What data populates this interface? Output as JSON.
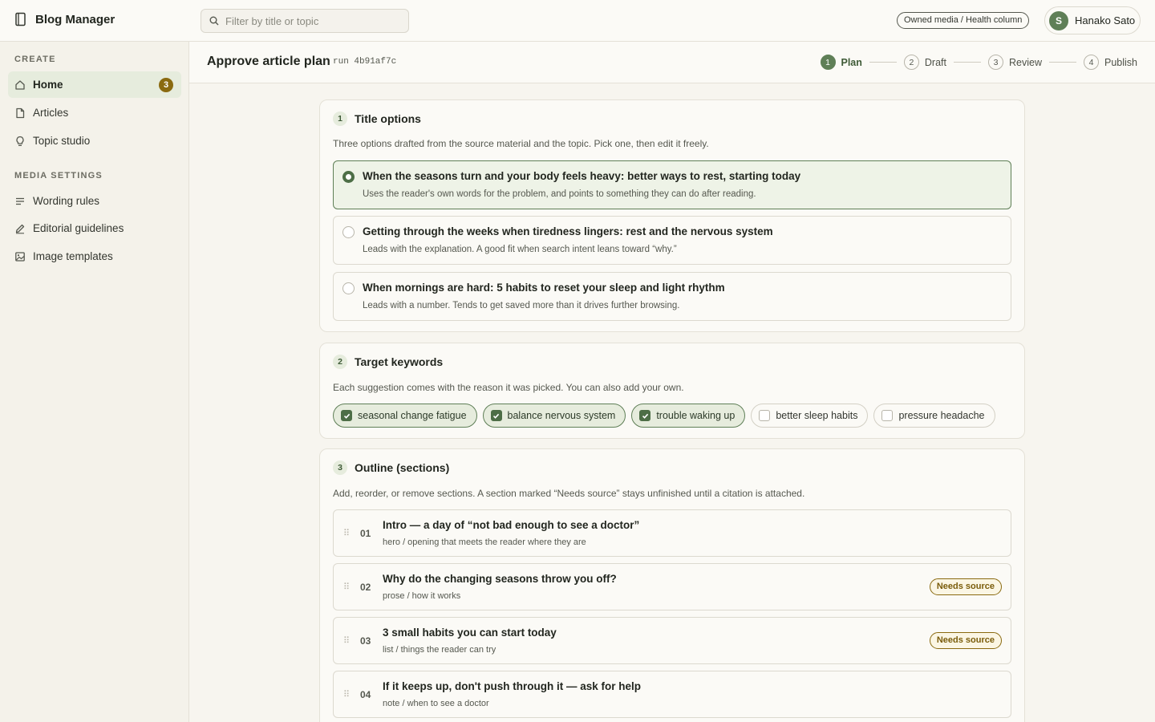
{
  "app": {
    "title": "Blog Manager"
  },
  "search": {
    "placeholder": "Filter by title or topic",
    "value": ""
  },
  "workspace": {
    "label": "Owned media / Health column"
  },
  "user": {
    "initial": "S",
    "name": "Hanako Sato"
  },
  "sidebar": {
    "create_heading": "CREATE",
    "create_items": [
      {
        "label": "Home",
        "icon": "home-icon",
        "badge": "3",
        "active": true
      },
      {
        "label": "Articles",
        "icon": "file-icon"
      },
      {
        "label": "Topic studio",
        "icon": "lightbulb-icon"
      }
    ],
    "media_heading": "MEDIA SETTINGS",
    "media_items": [
      {
        "label": "Wording rules",
        "icon": "lines-icon"
      },
      {
        "label": "Editorial guidelines",
        "icon": "pen-icon"
      },
      {
        "label": "Image templates",
        "icon": "image-icon"
      }
    ]
  },
  "header": {
    "title": "Approve article plan",
    "run_id": "run 4b91af7c",
    "steps": [
      {
        "num": "1",
        "label": "Plan",
        "active": true
      },
      {
        "num": "2",
        "label": "Draft"
      },
      {
        "num": "3",
        "label": "Review"
      },
      {
        "num": "4",
        "label": "Publish"
      }
    ]
  },
  "titles_card": {
    "num": "1",
    "title": "Title options",
    "desc": "Three options drafted from the source material and the topic. Pick one, then edit it freely.",
    "options": [
      {
        "title": "When the seasons turn and your body feels heavy: better ways to rest, starting today",
        "sub": "Uses the reader's own words for the problem, and points to something they can do after reading.",
        "selected": true
      },
      {
        "title": "Getting through the weeks when tiredness lingers: rest and the nervous system",
        "sub": "Leads with the explanation. A good fit when search intent leans toward “why.”"
      },
      {
        "title": "When mornings are hard: 5 habits to reset your sleep and light rhythm",
        "sub": "Leads with a number. Tends to get saved more than it drives further browsing."
      }
    ]
  },
  "keywords_card": {
    "num": "2",
    "title": "Target keywords",
    "desc": "Each suggestion comes with the reason it was picked. You can also add your own.",
    "keywords": [
      {
        "label": "seasonal change fatigue",
        "checked": true
      },
      {
        "label": "balance nervous system",
        "checked": true
      },
      {
        "label": "trouble waking up",
        "checked": true
      },
      {
        "label": "better sleep habits",
        "checked": false
      },
      {
        "label": "pressure headache",
        "checked": false
      }
    ]
  },
  "outline_card": {
    "num": "3",
    "title": "Outline (sections)",
    "desc": "Add, reorder, or remove sections. A section marked “Needs source” stays unfinished until a citation is attached.",
    "sections": [
      {
        "num": "01",
        "title": "Intro — a day of “not bad enough to see a doctor”",
        "sub": "hero / opening that meets the reader where they are",
        "badge": ""
      },
      {
        "num": "02",
        "title": "Why do the changing seasons throw you off?",
        "sub": "prose / how it works",
        "badge": "Needs source"
      },
      {
        "num": "03",
        "title": "3 small habits you can start today",
        "sub": "list / things the reader can try",
        "badge": "Needs source"
      },
      {
        "num": "04",
        "title": "If it keeps up, don't push through it — ask for help",
        "sub": "note / when to see a doctor",
        "badge": ""
      }
    ]
  },
  "colors": {
    "accent": "#5f7f57",
    "warning": "#8a6a10",
    "background": "#f7f5ef"
  }
}
